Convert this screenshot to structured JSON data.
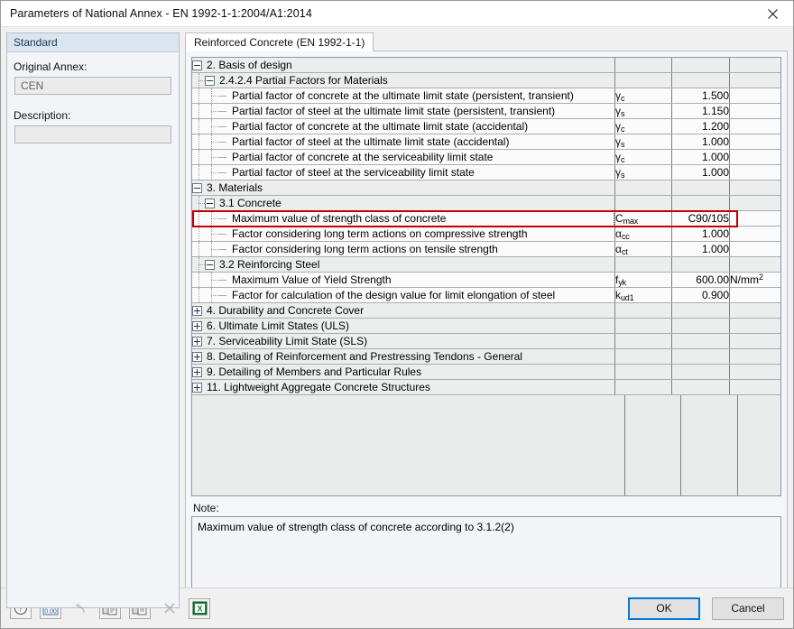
{
  "window": {
    "title": "Parameters of National Annex - EN 1992-1-1:2004/A1:2014",
    "close_icon": "close-icon"
  },
  "left_panel": {
    "header": "Standard",
    "original_annex_label": "Original Annex:",
    "original_annex_value": "CEN",
    "description_label": "Description:",
    "description_value": ""
  },
  "tabs": [
    {
      "label": "Reinforced Concrete (EN 1992-1-1)",
      "active": true
    }
  ],
  "note": {
    "label": "Note:",
    "text": "Maximum value of strength class of concrete according to 3.1.2(2)"
  },
  "toolbar": [
    {
      "name": "help-icon",
      "title": "Help",
      "disabled": false
    },
    {
      "name": "units-icon",
      "title": "Units and Decimal Places",
      "disabled": false
    },
    {
      "name": "undo-icon",
      "title": "Undo",
      "disabled": true
    },
    {
      "name": "copy-icon",
      "title": "Copy",
      "disabled": false
    },
    {
      "name": "paste-icon",
      "title": "Paste",
      "disabled": false
    },
    {
      "name": "delete-icon",
      "title": "Delete",
      "disabled": true
    },
    {
      "name": "excel-icon",
      "title": "Export to MS Excel",
      "disabled": false
    }
  ],
  "buttons": {
    "ok": "OK",
    "cancel": "Cancel"
  },
  "colors": {
    "highlight_border": "#c00000",
    "focus_border": "#0078d7",
    "header_band": "#dbe5ef",
    "grid_empty": "#e8edeb"
  },
  "grid": {
    "rows": [
      {
        "type": "group",
        "level": 0,
        "expanded": true,
        "label": "2. Basis of design",
        "symbol": "",
        "value": "",
        "unit": ""
      },
      {
        "type": "group",
        "level": 1,
        "expanded": true,
        "label": "2.4.2.4 Partial Factors for Materials",
        "symbol": "",
        "value": "",
        "unit": ""
      },
      {
        "type": "item",
        "level": 2,
        "label": "Partial factor of concrete at the ultimate limit state (persistent, transient)",
        "symbol": "γ",
        "sub": "c",
        "value": "1.500",
        "unit": ""
      },
      {
        "type": "item",
        "level": 2,
        "label": "Partial factor of steel at the ultimate limit state (persistent, transient)",
        "symbol": "γ",
        "sub": "s",
        "value": "1.150",
        "unit": ""
      },
      {
        "type": "item",
        "level": 2,
        "label": "Partial factor of concrete at the ultimate limit state (accidental)",
        "symbol": "γ",
        "sub": "c",
        "value": "1.200",
        "unit": ""
      },
      {
        "type": "item",
        "level": 2,
        "label": "Partial factor of steel at the ultimate limit state (accidental)",
        "symbol": "γ",
        "sub": "s",
        "value": "1.000",
        "unit": ""
      },
      {
        "type": "item",
        "level": 2,
        "label": "Partial factor of concrete at the serviceability limit state",
        "symbol": "γ",
        "sub": "c",
        "value": "1.000",
        "unit": ""
      },
      {
        "type": "item",
        "level": 2,
        "label": "Partial factor of steel at the serviceability limit state",
        "symbol": "γ",
        "sub": "s",
        "value": "1.000",
        "unit": ""
      },
      {
        "type": "group",
        "level": 0,
        "expanded": true,
        "label": "3. Materials",
        "symbol": "",
        "value": "",
        "unit": ""
      },
      {
        "type": "group",
        "level": 1,
        "expanded": true,
        "label": "3.1 Concrete",
        "symbol": "",
        "value": "",
        "unit": ""
      },
      {
        "type": "item",
        "level": 2,
        "label": "Maximum value of strength class of concrete",
        "symbol": "C",
        "sub": "max",
        "value": "C90/105",
        "unit": "",
        "selected": true,
        "highlighted": true
      },
      {
        "type": "item",
        "level": 2,
        "label": "Factor considering long term actions on compressive strength",
        "symbol": "α",
        "sub": "cc",
        "value": "1.000",
        "unit": ""
      },
      {
        "type": "item",
        "level": 2,
        "label": "Factor considering long term actions on tensile strength",
        "symbol": "α",
        "sub": "ct",
        "value": "1.000",
        "unit": ""
      },
      {
        "type": "group",
        "level": 1,
        "expanded": true,
        "label": "3.2 Reinforcing Steel",
        "symbol": "",
        "value": "",
        "unit": ""
      },
      {
        "type": "item",
        "level": 2,
        "label": "Maximum Value of Yield Strength",
        "symbol": "f",
        "sub": "yk",
        "value": "600.00",
        "unit": "N/mm²"
      },
      {
        "type": "item",
        "level": 2,
        "label": "Factor for calculation of the design value for limit elongation of steel",
        "symbol": "k",
        "sub": "ud1",
        "value": "0.900",
        "unit": ""
      },
      {
        "type": "group",
        "level": 0,
        "expanded": false,
        "label": "4. Durability and Concrete Cover",
        "symbol": "",
        "value": "",
        "unit": ""
      },
      {
        "type": "group",
        "level": 0,
        "expanded": false,
        "label": "6. Ultimate Limit States (ULS)",
        "symbol": "",
        "value": "",
        "unit": ""
      },
      {
        "type": "group",
        "level": 0,
        "expanded": false,
        "label": "7. Serviceability Limit State (SLS)",
        "symbol": "",
        "value": "",
        "unit": ""
      },
      {
        "type": "group",
        "level": 0,
        "expanded": false,
        "label": "8. Detailing of Reinforcement and Prestressing Tendons - General",
        "symbol": "",
        "value": "",
        "unit": ""
      },
      {
        "type": "group",
        "level": 0,
        "expanded": false,
        "label": "9. Detailing of Members and Particular Rules",
        "symbol": "",
        "value": "",
        "unit": ""
      },
      {
        "type": "group",
        "level": 0,
        "expanded": false,
        "label": "11. Lightweight Aggregate Concrete Structures",
        "symbol": "",
        "value": "",
        "unit": ""
      }
    ]
  }
}
